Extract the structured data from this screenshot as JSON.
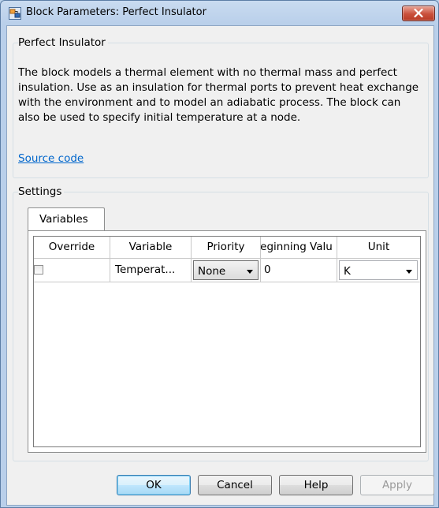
{
  "window": {
    "title": "Block Parameters: Perfect Insulator"
  },
  "block_group": {
    "title": "Perfect Insulator",
    "description": "The block models a thermal element with no thermal mass and perfect insulation. Use as an insulation for thermal ports to prevent heat exchange with the environment and to model an adiabatic process. The block can also be used to specify initial temperature at a node.",
    "source_link": "Source code"
  },
  "settings": {
    "title": "Settings",
    "tabs": [
      {
        "label": "Variables",
        "selected": true
      }
    ],
    "table": {
      "columns": [
        "Override",
        "Variable",
        "Priority",
        "eginning Valu",
        "Unit"
      ],
      "rows": [
        {
          "override": false,
          "variable": "Temperat...",
          "priority": "None",
          "beginning_value": "0",
          "unit": "K"
        }
      ]
    }
  },
  "buttons": {
    "ok": "OK",
    "cancel": "Cancel",
    "help": "Help",
    "apply": "Apply"
  },
  "colors": {
    "link": "#0066cc",
    "close_button": "#c9503b",
    "window_frame": "#b9cfea"
  }
}
